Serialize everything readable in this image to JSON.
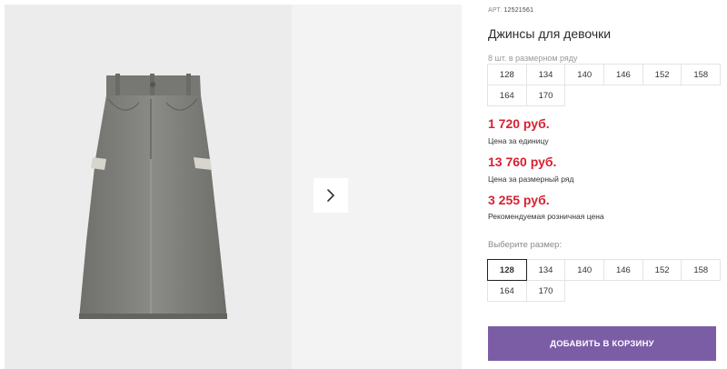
{
  "product": {
    "art_label": "АРТ.",
    "art_number": "12521561",
    "title": "Джинсы для девочки",
    "pack_note": "8 шт. в размерном ряду",
    "pack_sizes": [
      "128",
      "134",
      "140",
      "146",
      "152",
      "158",
      "164",
      "170"
    ]
  },
  "prices": {
    "unit_price": "1 720 руб.",
    "unit_caption": "Цена за единицу",
    "pack_price": "13 760 руб.",
    "pack_caption": "Цена за размерный ряд",
    "retail_price": "3 255 руб.",
    "retail_caption": "Рекомендуемая розничная цена"
  },
  "size_picker": {
    "label": "Выберите размер:",
    "sizes": [
      "128",
      "134",
      "140",
      "146",
      "152",
      "158",
      "164",
      "170"
    ],
    "selected": "128"
  },
  "cart": {
    "button_label": "ДОБАВИТЬ В КОРЗИНУ"
  },
  "colors": {
    "price_red": "#d62233",
    "cart_purple": "#7b5da6",
    "photo_bg": "#ececec",
    "denim_grey": "#7d7d79"
  },
  "icons": {
    "next": "chevron-right-icon"
  }
}
